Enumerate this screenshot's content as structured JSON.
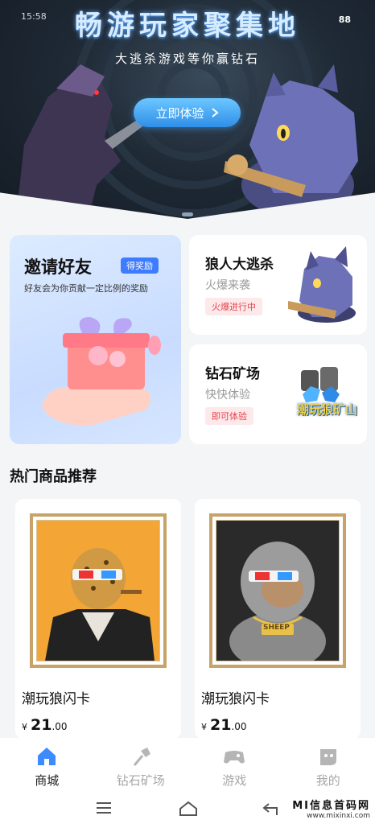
{
  "status_bar": {
    "left_text": "15:58",
    "right_text": "88"
  },
  "banner": {
    "title": "畅游玩家聚集地",
    "subtitle": "大逃杀游戏等你赢钻石",
    "cta_label": "立即体验",
    "cta_icon": "chevron-right-icon"
  },
  "invite_card": {
    "title": "邀请好友",
    "badge": "得奖励",
    "desc": "好友会为你贡献一定比例的奖励"
  },
  "wolf_card": {
    "title": "狼人大逃杀",
    "sub": "火爆来袭",
    "tag": "火爆进行中"
  },
  "mine_card": {
    "title": "钻石矿场",
    "sub": "快快体验",
    "tag": "即可体验",
    "art_text": "潮玩狼矿山"
  },
  "section": {
    "title": "热门商品推荐"
  },
  "products": [
    {
      "name": "潮玩狼闪卡",
      "currency": "¥",
      "price_int": "21",
      "price_dec": ".00"
    },
    {
      "name": "潮玩狼闪卡",
      "currency": "¥",
      "price_int": "21",
      "price_dec": ".00",
      "chain_text": "SHEEP"
    }
  ],
  "tabs": [
    {
      "label": "商城",
      "icon": "home-icon",
      "active": true
    },
    {
      "label": "钻石矿场",
      "icon": "shovel-icon",
      "active": false
    },
    {
      "label": "游戏",
      "icon": "gamepad-icon",
      "active": false
    },
    {
      "label": "我的",
      "icon": "profile-icon",
      "active": false
    }
  ],
  "watermark": {
    "line1": "MI信息首码网",
    "line2": "www.mixinxi.com"
  },
  "colors": {
    "accent": "#3d7bff",
    "tag_red": "#e4464f",
    "tab_active": "#3d8bff",
    "frame_gold": "#c7a36a"
  }
}
